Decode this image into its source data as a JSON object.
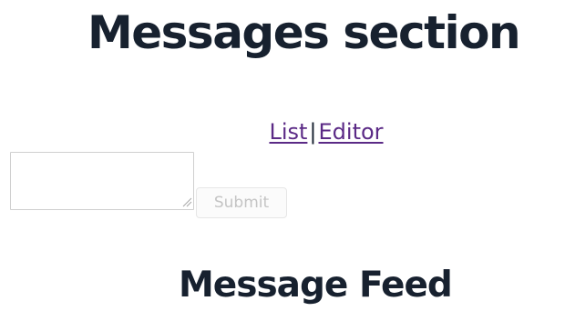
{
  "header": {
    "title": "Messages section"
  },
  "nav": {
    "list_label": "List",
    "separator": "|",
    "editor_label": "Editor",
    "link_color": "#5b2a86"
  },
  "composer": {
    "message_value": "",
    "submit_label": "Submit",
    "submit_disabled": true
  },
  "feed": {
    "title": "Message Feed"
  }
}
